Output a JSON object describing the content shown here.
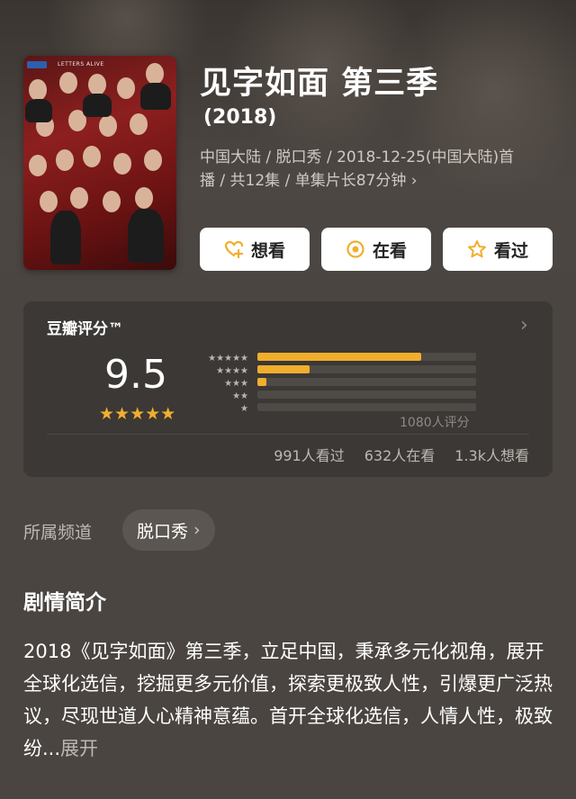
{
  "header": {
    "title": "见字如面 第三季",
    "year": "(2018)",
    "meta_line1": "中国大陆 / 脱口秀 / 2018-12-25(中国大陆)首",
    "meta_line2": "播 / 共12集 / 单集片长87分钟",
    "meta_chevron": "›",
    "poster_tag": "LETTERS ALIVE"
  },
  "actions": {
    "want": "想看",
    "watching": "在看",
    "watched": "看过"
  },
  "rating": {
    "title": "豆瓣评分™",
    "chevron": "›",
    "score": "9.5",
    "stars": "★★★★★",
    "star_labels": [
      "★★★★★",
      "★★★★",
      "★★★",
      "★★",
      "★"
    ],
    "distribution_percent": [
      75,
      24,
      4,
      0,
      0
    ],
    "count": "1080人评分",
    "stats": {
      "watched": "991人看过",
      "watching": "632人在看",
      "want": "1.3k人想看"
    },
    "accent_color": "#f1ae2d"
  },
  "channel": {
    "label": "所属频道",
    "chip": "脱口秀",
    "chip_chevron": "›"
  },
  "synopsis": {
    "title": "剧情简介",
    "text": "2018《见字如面》第三季，立足中国，秉承多元化视角，展开全球化选信，挖掘更多元价值，探索更极致人性，引爆更广泛热议，尽现世道人心精神意蕴。首开全球化选信，人情人性，极致纷...",
    "more": "展开"
  }
}
